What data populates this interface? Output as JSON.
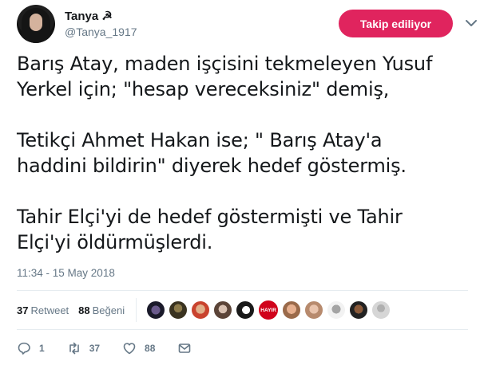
{
  "user": {
    "display_name": "Tanya ☭",
    "handle": "@Tanya_1917"
  },
  "follow_button": {
    "label": "Takip ediliyor",
    "color": "#e0245e"
  },
  "tweet": {
    "text": "Barış Atay, maden işçisini tekmeleyen Yusuf\nYerkel için; \"hesap vereceksiniz\" demiş,\n\nTetikçi Ahmet Hakan ise; \" Barış Atay'a\nhaddini bildirin\" diyerek hedef göstermiş.\n\nTahir Elçi'yi de hedef göstermişti ve Tahir\nElçi'yi öldürmüşlerdi.",
    "timestamp": "11:34 - 15 May 2018"
  },
  "stats": {
    "retweets_count": "37",
    "retweets_label": "Retweet",
    "likes_count": "88",
    "likes_label": "Beğeni",
    "liker_badge_text": "HAYIR"
  },
  "actions": {
    "reply_count": "1",
    "retweet_count": "37",
    "like_count": "88"
  },
  "icons": {
    "reply": "reply-icon",
    "retweet": "retweet-icon",
    "like": "heart-icon",
    "message": "message-icon",
    "more": "chevron-down-icon"
  }
}
